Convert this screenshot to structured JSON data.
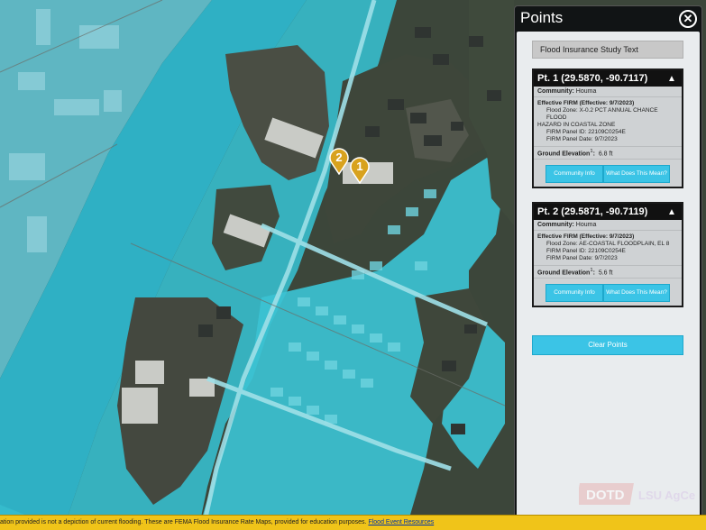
{
  "map": {
    "pins": [
      {
        "number": "2",
        "color": "#d8a21e"
      },
      {
        "number": "1",
        "color": "#d8a21e"
      }
    ],
    "colors": {
      "flood_zone": "#38c3d6",
      "land": "#3a4438",
      "river": "#2fb4c8"
    }
  },
  "panel": {
    "title": "Points",
    "close_icon": "close-circle-icon",
    "study_button": "Flood Insurance Study Text",
    "points": [
      {
        "header": "Pt. 1 (29.5870, -90.7117)",
        "community_label": "Community:",
        "community": "Houma",
        "firm_title": "Effective FIRM (Effective:  9/7/2023)",
        "flood_zone_line1": "Flood Zone: X-0.2 PCT ANNUAL CHANCE FLOOD",
        "flood_zone_line2": "HAZARD IN COASTAL ZONE",
        "panel_id": "FIRM Panel ID: 22109C0254E",
        "panel_date": "FIRM Panel Date: 9/7/2023",
        "elevation_label": "Ground Elevation",
        "elevation_sup": "1",
        "elevation": "6.8 ft",
        "community_info_btn": "Community Info",
        "meaning_btn": "What Does This Mean?"
      },
      {
        "header": "Pt. 2 (29.5871, -90.7119)",
        "community_label": "Community:",
        "community": "Houma",
        "firm_title": "Effective FIRM (Effective:  9/7/2023)",
        "flood_zone_line1": "Flood Zone: AE-COASTAL FLOODPLAIN, EL 8",
        "flood_zone_line2": "",
        "panel_id": "FIRM Panel ID: 22109C0254E",
        "panel_date": "FIRM Panel Date: 9/7/2023",
        "elevation_label": "Ground Elevation",
        "elevation_sup": "1",
        "elevation": "5.6 ft",
        "community_info_btn": "Community Info",
        "meaning_btn": "What Does This Mean?"
      }
    ],
    "clear_button": "Clear Points",
    "logo_left": "DOTD",
    "logo_right": "LSU AgCenter"
  },
  "footer": {
    "text": "ation provided is not a depiction of current flooding. These are FEMA Flood Insurance Rate Maps, provided for education purposes.",
    "link": "Flood Event Resources"
  }
}
